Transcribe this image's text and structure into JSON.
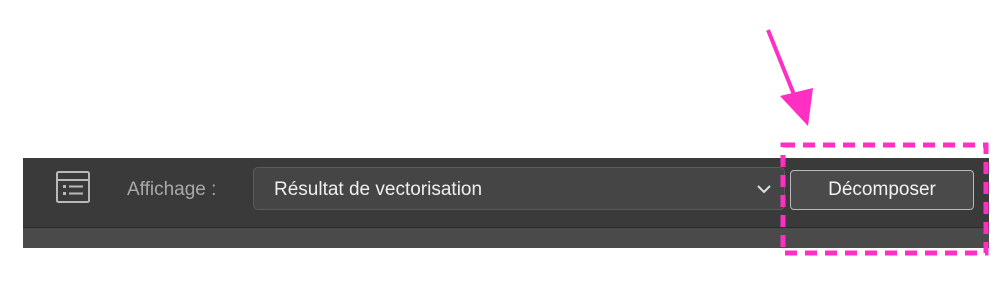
{
  "toolbar": {
    "panel_icon": "panel-list-icon",
    "view_label": "Affichage :",
    "view_select": {
      "selected": "Résultat de vectorisation",
      "chevron_icon": "chevron-down-icon"
    },
    "decompose_button": "Décomposer"
  },
  "colors": {
    "toolbar_bg": "#3a3a3a",
    "annotation_accent": "#ff2fc4"
  }
}
